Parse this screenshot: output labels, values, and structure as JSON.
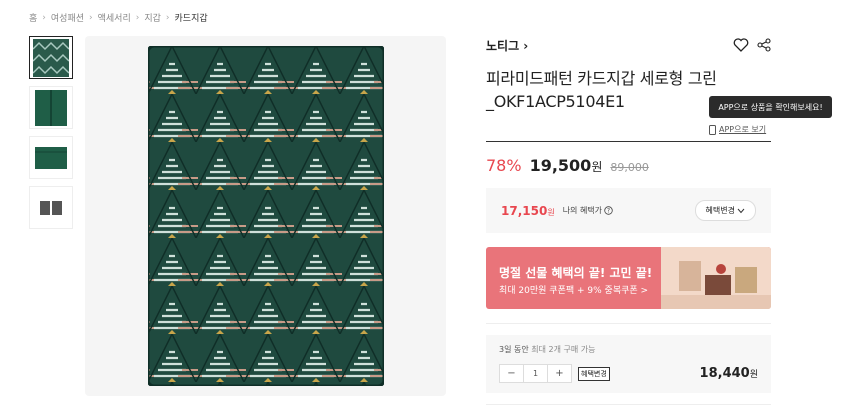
{
  "breadcrumb": [
    "홈",
    "여성패션",
    "액세서리",
    "지갑",
    "카드지갑"
  ],
  "product": {
    "brand": "노티그",
    "title": "피라미드패턴 카드지갑 세로형 그린 _OKF1ACP5104E1",
    "tooltip": "APP으로 상품을 확인해보세요!",
    "app_link": "APP으로 보기",
    "discount": "78%",
    "price": "19,500",
    "price_unit": "원",
    "original_price": "89,000"
  },
  "benefit": {
    "price": "17,150",
    "unit": "원",
    "label": "나의 혜택가",
    "button": "혜택변경"
  },
  "banner": {
    "title": "명절 선물 혜택의 끝! 고민 끝!",
    "subtitle": "최대 20만원 쿠폰팩 + 9% 중복쿠폰 >"
  },
  "quantity": {
    "note_prefix": "3일 동안",
    "note_limit": "최대 2개 구매 가능",
    "value": "1",
    "minus": "−",
    "plus": "+",
    "change_btn": "혜택변경",
    "total": "18,440",
    "total_unit": "원"
  },
  "colors": {
    "accent": "#e8474f",
    "banner": "#e9747a",
    "wallet": "#1f4a3f"
  },
  "icons": [
    "chevron-right-icon",
    "heart-icon",
    "share-icon",
    "phone-icon",
    "info-icon",
    "chevron-down-icon"
  ]
}
